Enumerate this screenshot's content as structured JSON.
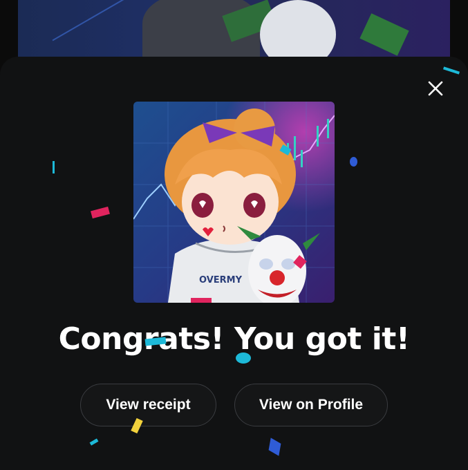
{
  "modal": {
    "title": "Congrats! You got it!",
    "close_icon": "close-icon"
  },
  "avatar": {
    "subject": "anime character avatar with joker mask",
    "shirt_text": "OVERMY"
  },
  "buttons": {
    "receipt_label": "View receipt",
    "profile_label": "View on Profile"
  },
  "colors": {
    "sheet_bg": "#111213",
    "text": "#ffffff",
    "button_border": "#3a3c40",
    "confetti_pink": "#e0245e",
    "confetti_cyan": "#1db9d8",
    "confetti_yellow": "#f2d23c",
    "confetti_blue": "#2f5cd6"
  }
}
